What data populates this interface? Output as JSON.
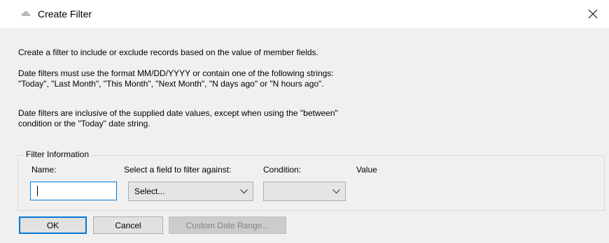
{
  "window": {
    "title": "Create Filter"
  },
  "info": {
    "line1": "Create a filter to include or exclude records based on the value of member fields.",
    "line2a": "Date filters must use the format MM/DD/YYYY or contain one of the following strings:",
    "line2b": "\"Today\", \"Last Month\", \"This Month\", \"Next Month\", \"N days ago\" or \"N hours ago\".",
    "line3a": "Date filters are inclusive of the supplied date values, except when using the \"between\"",
    "line3b": "condition or the \"Today\" date string."
  },
  "group": {
    "legend": "Filter Information",
    "name_label": "Name:",
    "field_label": "Select a field to filter against:",
    "condition_label": "Condition:",
    "value_label": "Value",
    "name_value": "",
    "field_selected": "Select...",
    "condition_selected": ""
  },
  "buttons": {
    "ok": "OK",
    "cancel": "Cancel",
    "custom_date_range": "Custom Date Range..."
  },
  "icons": {
    "app": "cloud-icon",
    "close": "close-icon",
    "dropdown": "chevron-down-icon"
  },
  "colors": {
    "focus": "#0078d7",
    "background": "#f0f0f0",
    "titlebar": "#ffffff"
  }
}
